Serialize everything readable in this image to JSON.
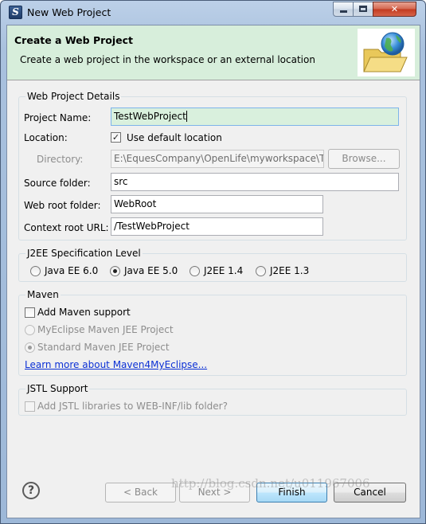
{
  "window": {
    "title": "New Web Project"
  },
  "banner": {
    "title": "Create a Web Project",
    "subtitle": "Create a web project in the workspace or an external location"
  },
  "details": {
    "group_label": "Web Project Details",
    "project_name_label": "Project Name:",
    "project_name_value": "TestWebProject",
    "location_label": "Location:",
    "use_default_label": "Use default location",
    "use_default_checked": true,
    "directory_label": "Directory:",
    "directory_value": "E:\\EquesCompany\\OpenLife\\myworkspace\\Te",
    "browse_label": "Browse...",
    "source_folder_label": "Source folder:",
    "source_folder_value": "src",
    "web_root_label": "Web root folder:",
    "web_root_value": "WebRoot",
    "context_root_label": "Context root URL:",
    "context_root_value": "/TestWebProject"
  },
  "j2ee": {
    "group_label": "J2EE Specification Level",
    "options": [
      "Java EE 6.0",
      "Java EE 5.0",
      "J2EE 1.4",
      "J2EE 1.3"
    ],
    "selected": "Java EE 5.0"
  },
  "maven": {
    "group_label": "Maven",
    "add_support_label": "Add Maven support",
    "add_support_checked": false,
    "option_myeclipse": "MyEclipse Maven JEE Project",
    "option_standard": "Standard Maven JEE Project",
    "selected": "Standard Maven JEE Project",
    "learn_more_link": "Learn more about Maven4MyEclipse..."
  },
  "jstl": {
    "group_label": "JSTL Support",
    "add_jstl_label": "Add JSTL libraries to WEB-INF/lib folder?",
    "add_jstl_checked": false
  },
  "footer": {
    "help_symbol": "?",
    "back_label": "< Back",
    "next_label": "Next >",
    "finish_label": "Finish",
    "cancel_label": "Cancel"
  },
  "watermark": "http://blog.csdn.net/u011967006",
  "colors": {
    "banner_bg": "#d7eedb",
    "selected_field_bg": "#d9f0dd",
    "link": "#0b30d5",
    "close_button": "#c2391f"
  }
}
